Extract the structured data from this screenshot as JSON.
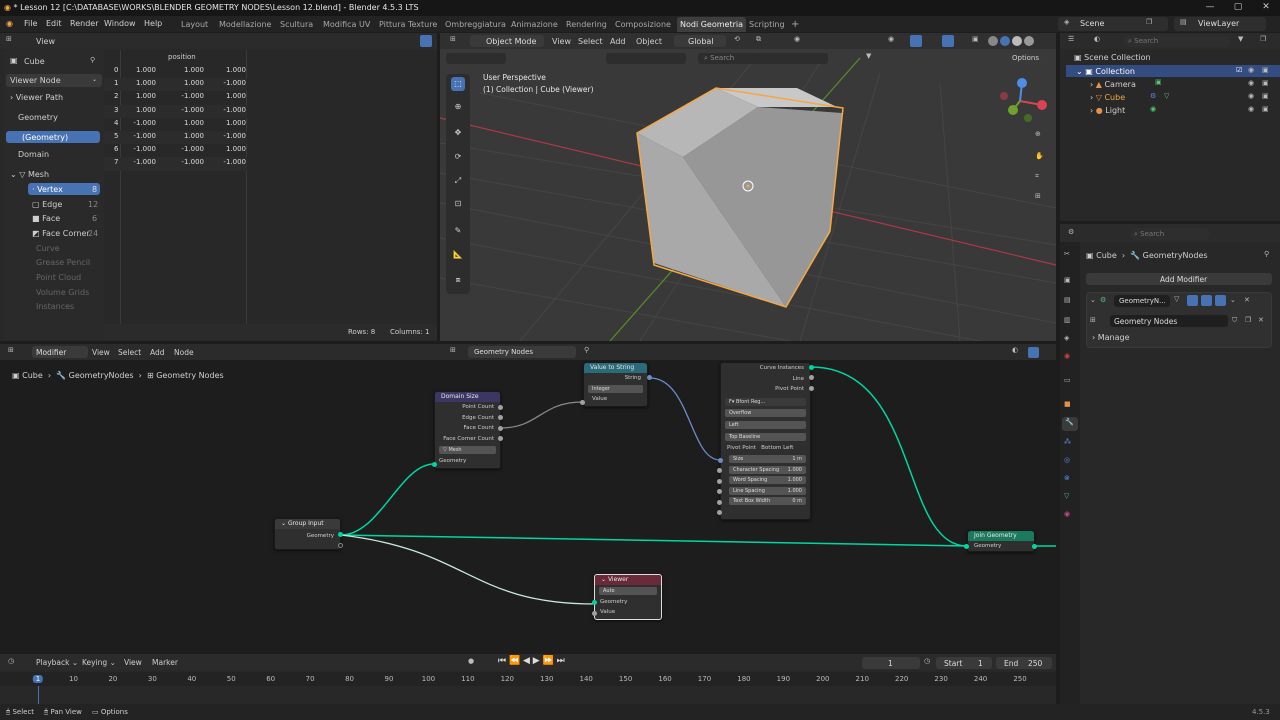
{
  "window_title": "* Lesson 12 [C:\\DATABASE\\WORKS\\BLENDER GEOMETRY NODES\\Lesson 12.blend] - Blender 4.5.3 LTS",
  "menus": [
    "File",
    "Edit",
    "Render",
    "Window",
    "Help"
  ],
  "workspaces": [
    "Layout",
    "Modellazione",
    "Scultura",
    "Modifica UV",
    "Pittura Texture",
    "Ombreggiatura",
    "Animazione",
    "Rendering",
    "Composizione",
    "Nodi Geometria",
    "Scripting"
  ],
  "scene": "Scene",
  "view_layer": "ViewLayer",
  "spreadsheet": {
    "view": "View",
    "object": "Cube",
    "viewer": "Viewer Node",
    "viewer_path": "Viewer Path",
    "geometry": "Geometry",
    "geo_item": "(Geometry)",
    "domain": "Domain",
    "mesh": "Mesh",
    "domains": [
      {
        "name": "Vertex",
        "count": "8"
      },
      {
        "name": "Edge",
        "count": "12"
      },
      {
        "name": "Face",
        "count": "6"
      },
      {
        "name": "Face Corner",
        "count": "24"
      }
    ],
    "others": [
      "Curve",
      "Grease Pencil",
      "Point Cloud",
      "Volume Grids",
      "Instances"
    ],
    "col_header": "position",
    "rows": [
      [
        "0",
        "1.000",
        "1.000",
        "1.000"
      ],
      [
        "1",
        "1.000",
        "1.000",
        "-1.000"
      ],
      [
        "2",
        "1.000",
        "-1.000",
        "1.000"
      ],
      [
        "3",
        "1.000",
        "-1.000",
        "-1.000"
      ],
      [
        "4",
        "-1.000",
        "1.000",
        "1.000"
      ],
      [
        "5",
        "-1.000",
        "1.000",
        "-1.000"
      ],
      [
        "6",
        "-1.000",
        "-1.000",
        "1.000"
      ],
      [
        "7",
        "-1.000",
        "-1.000",
        "-1.000"
      ]
    ],
    "rows_label": "Rows: 8",
    "cols_label": "Columns: 1"
  },
  "viewport": {
    "mode": "Object Mode",
    "menus": [
      "View",
      "Select",
      "Add",
      "Object"
    ],
    "orient": "Global",
    "search": "Search",
    "options": "Options",
    "persp": "User Perspective",
    "collection": "(1) Collection | Cube (Viewer)"
  },
  "outliner": {
    "search": "Search",
    "scene_collection": "Scene Collection",
    "collection": "Collection",
    "items": [
      "Camera",
      "Cube",
      "Light"
    ]
  },
  "properties": {
    "search": "Search",
    "crumb_obj": "Cube",
    "crumb_mod": "GeometryNodes",
    "add_modifier": "Add Modifier",
    "modifier_name": "GeometryN...",
    "node_group": "Geometry Nodes",
    "manage": "Manage"
  },
  "node_editor": {
    "editor": "Modifier",
    "menus": [
      "View",
      "Select",
      "Add",
      "Node"
    ],
    "tree": "Geometry Nodes",
    "crumbs": [
      "Cube",
      "GeometryNodes",
      "Geometry Nodes"
    ],
    "domain_size": {
      "title": "Domain Size",
      "outputs": [
        "Point Count",
        "Edge Count",
        "Face Count",
        "Face Corner Count"
      ],
      "dropdown": "Mesh",
      "input": "Geometry"
    },
    "value_to_string": {
      "title": "Value to String",
      "output": "String",
      "dropdown": "Integer",
      "input": "Value"
    },
    "string_curves": {
      "outputs": [
        "Curve Instances",
        "Line",
        "Pivot Point"
      ],
      "font": "Bfont Reg...",
      "overflow": "Overflow",
      "align_x": "Left",
      "align_y": "Top Baseline",
      "pivot_label": "Pivot Point",
      "pivot_value": "Bottom Left",
      "fields": [
        {
          "label": "Size",
          "value": "1 m"
        },
        {
          "label": "Character Spacing",
          "value": "1.000"
        },
        {
          "label": "Word Spacing",
          "value": "1.000"
        },
        {
          "label": "Line Spacing",
          "value": "1.000"
        },
        {
          "label": "Text Box Width",
          "value": "0 m"
        }
      ]
    },
    "group_input": {
      "title": "Group Input",
      "output": "Geometry"
    },
    "join": {
      "title": "Join Geometry",
      "input": "Geometry"
    },
    "viewer": {
      "title": "Viewer",
      "dropdown": "Auto",
      "inputs": [
        "Geometry",
        "Value"
      ]
    }
  },
  "timeline": {
    "menus": [
      "Playback",
      "Keying",
      "View",
      "Marker"
    ],
    "current": "1",
    "start_label": "Start",
    "start": "1",
    "end_label": "End",
    "end": "250",
    "ticks": [
      "1",
      "10",
      "20",
      "30",
      "40",
      "50",
      "60",
      "70",
      "80",
      "90",
      "100",
      "110",
      "120",
      "130",
      "140",
      "150",
      "160",
      "170",
      "180",
      "190",
      "200",
      "210",
      "220",
      "230",
      "240",
      "250"
    ]
  },
  "status": {
    "select": "Select",
    "pan": "Pan View",
    "options": "Options",
    "version": "4.5.3"
  }
}
